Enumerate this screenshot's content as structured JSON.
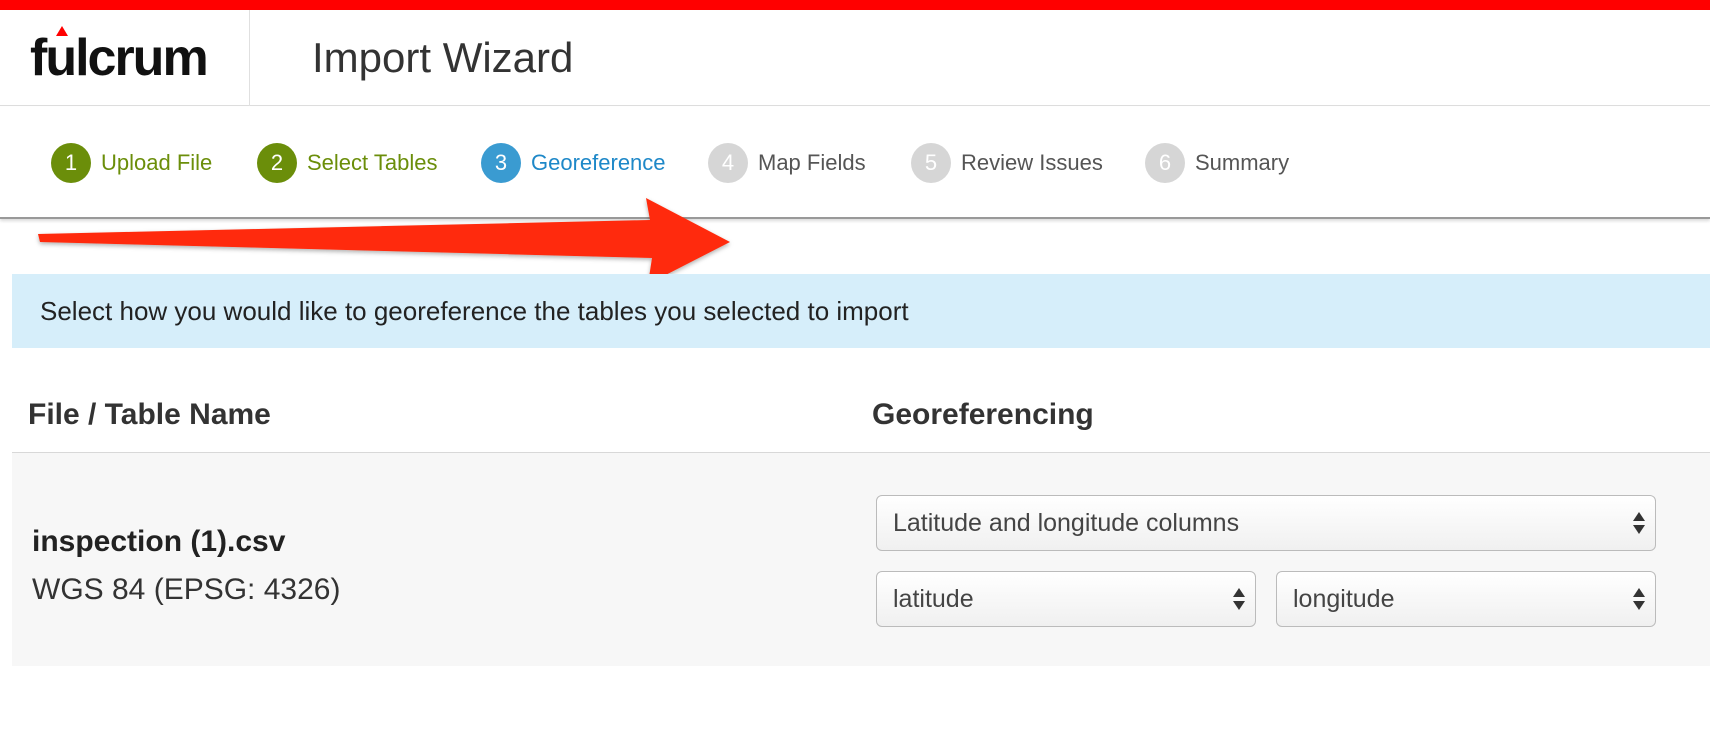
{
  "app": {
    "logo_text": "fulcrum",
    "page_title": "Import Wizard"
  },
  "colors": {
    "top_bar": "#ff0000",
    "step_done": "#6b8e0a",
    "step_active": "#3a9bd1",
    "step_todo": "#d6d6d6",
    "banner_bg": "#d6eefa",
    "annotation_arrow": "#ff2a0a"
  },
  "steps": [
    {
      "number": "1",
      "label": "Upload File",
      "state": "done"
    },
    {
      "number": "2",
      "label": "Select Tables",
      "state": "done"
    },
    {
      "number": "3",
      "label": "Georeference",
      "state": "active"
    },
    {
      "number": "4",
      "label": "Map Fields",
      "state": "todo"
    },
    {
      "number": "5",
      "label": "Review Issues",
      "state": "todo"
    },
    {
      "number": "6",
      "label": "Summary",
      "state": "todo"
    }
  ],
  "annotation": {
    "icon": "red-arrow-icon"
  },
  "banner": {
    "text": "Select how you would like to georeference the tables you selected to import"
  },
  "table": {
    "headers": {
      "name": "File / Table Name",
      "georef": "Georeferencing"
    },
    "rows": [
      {
        "file_name": "inspection (1).csv",
        "crs": "WGS 84 (EPSG: 4326)",
        "method": "Latitude and longitude columns",
        "lat_column": "latitude",
        "lon_column": "longitude"
      }
    ]
  }
}
